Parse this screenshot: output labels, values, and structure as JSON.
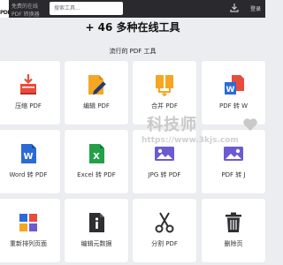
{
  "topbar": {
    "logo_tag": "PDF",
    "brand_line1": "免费的在线",
    "brand_line2": "PDF 转换器",
    "search_placeholder": "搜索工具...",
    "login_label": "登录"
  },
  "headline": "+ 46 多种在线工具",
  "subhead": "流行的 PDF 工具",
  "tools": [
    {
      "label": "压缩 PDF",
      "icon": "compress-icon"
    },
    {
      "label": "编辑 PDF",
      "icon": "edit-icon"
    },
    {
      "label": "合并 PDF",
      "icon": "merge-icon"
    },
    {
      "label": "PDF 转 W",
      "icon": "pdf-to-word-icon"
    },
    {
      "label": "Word 转 PDF",
      "icon": "word-icon"
    },
    {
      "label": "Excel 转 PDF",
      "icon": "excel-icon"
    },
    {
      "label": "JPG 转 PDF",
      "icon": "jpg-icon"
    },
    {
      "label": "PDF 转 J",
      "icon": "pdf-to-jpg-icon"
    },
    {
      "label": "重新排列页面",
      "icon": "rearrange-icon"
    },
    {
      "label": "编辑元数据",
      "icon": "metadata-icon"
    },
    {
      "label": "分割 PDF",
      "icon": "scissors-icon"
    },
    {
      "label": "删除页",
      "icon": "trash-icon"
    }
  ],
  "watermark": {
    "text": "科技师",
    "url": "https://www.3kjs.com"
  },
  "colors": {
    "topbar": "#2a2a2e",
    "background": "#ecedf0",
    "pdf_red": "#e94b3c",
    "word_blue": "#2b6bd6",
    "excel_green": "#24a148",
    "purple": "#6b5bd2",
    "orange": "#f5a623"
  }
}
